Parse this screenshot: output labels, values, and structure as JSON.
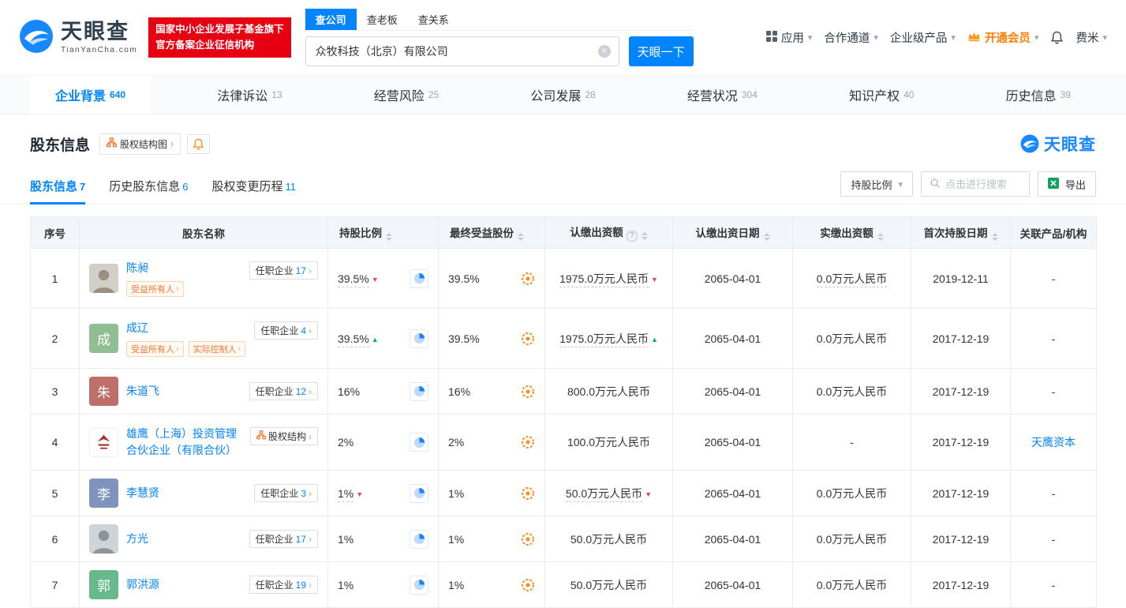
{
  "icons": {
    "caret_down": "▾",
    "arrow_right": "›",
    "close": "×",
    "question": "?",
    "up": "▲",
    "down": "▼"
  },
  "colors": {
    "accent_blue": "#0084ff",
    "badge_red": "#e60012",
    "vip_orange": "#ff8000",
    "trend_up_green": "#00b269",
    "trend_down_red": "#f3414d"
  },
  "brand": {
    "name": "天眼查",
    "domain": "TianYanCha.com",
    "badge_line1": "国家中小企业发展子基金旗下",
    "badge_line2": "官方备案企业征信机构"
  },
  "search": {
    "tabs": [
      {
        "label": "查公司"
      },
      {
        "label": "查老板"
      },
      {
        "label": "查关系"
      }
    ],
    "value": "众牧科技（北京）有限公司",
    "button": "天眼一下"
  },
  "topmenu": {
    "apps": "应用",
    "partner": "合作通道",
    "enterprise": "企业级产品",
    "vip": "开通会员",
    "user": "费米"
  },
  "nav_tabs": [
    {
      "label": "企业背景",
      "count": "640"
    },
    {
      "label": "法律诉讼",
      "count": "13"
    },
    {
      "label": "经营风险",
      "count": "25"
    },
    {
      "label": "公司发展",
      "count": "28"
    },
    {
      "label": "经营状况",
      "count": "304"
    },
    {
      "label": "知识产权",
      "count": "40"
    },
    {
      "label": "历史信息",
      "count": "39"
    }
  ],
  "section": {
    "title": "股东信息",
    "structure_chart": "股权结构图",
    "logo": "天眼查"
  },
  "sub_tabs": [
    {
      "label": "股东信息",
      "count": "7"
    },
    {
      "label": "历史股东信息",
      "count": "6"
    },
    {
      "label": "股权变更历程",
      "count": "11"
    }
  ],
  "controls": {
    "sort": "持股比例",
    "search_placeholder": "点击进行搜索",
    "export": "导出"
  },
  "table": {
    "headers": {
      "index": "序号",
      "name": "股东名称",
      "ratio": "持股比例",
      "final": "最终受益股份",
      "capital": "认缴出资额",
      "capital_date": "认缴出资日期",
      "paid": "实缴出资额",
      "first_date": "首次持股日期",
      "related": "关联产品/机构"
    },
    "rows": [
      {
        "index": "1",
        "name": "陈昶",
        "avatar_type": "photo",
        "badge_label": "任职企业",
        "badge_count": "17",
        "tags": [
          "受益所有人"
        ],
        "ratio": "39.5%",
        "ratio_trend": "down",
        "final": "39.5%",
        "capital": "1975.0万元人民币",
        "capital_trend": "down",
        "capital_date": "2065-04-01",
        "paid": "0.0万元人民币",
        "first_date": "2019-12-11",
        "related": "-"
      },
      {
        "index": "2",
        "name": "成辽",
        "avatar_type": "text",
        "avatar_text": "成",
        "avatar_color": "#8fbe93",
        "badge_label": "任职企业",
        "badge_count": "4",
        "tags": [
          "受益所有人",
          "实际控制人"
        ],
        "ratio": "39.5%",
        "ratio_trend": "up",
        "final": "39.5%",
        "capital": "1975.0万元人民币",
        "capital_trend": "up",
        "capital_date": "2065-04-01",
        "paid": "0.0万元人民币",
        "first_date": "2017-12-19",
        "related": "-"
      },
      {
        "index": "3",
        "name": "朱道飞",
        "avatar_type": "text",
        "avatar_text": "朱",
        "avatar_color": "#bd6f68",
        "badge_label": "任职企业",
        "badge_count": "12",
        "ratio": "16%",
        "final": "16%",
        "capital": "800.0万元人民币",
        "capital_date": "2065-04-01",
        "paid": "0.0万元人民币",
        "first_date": "2017-12-19",
        "related": "-"
      },
      {
        "index": "4",
        "name": "雄鹰（上海）投资管理合伙企业（有限合伙）",
        "avatar_type": "logo",
        "badge_label": "股权结构",
        "ratio": "2%",
        "final": "2%",
        "capital": "100.0万元人民币",
        "capital_date": "2065-04-01",
        "paid": "-",
        "first_date": "2017-12-19",
        "related": "天鹰资本"
      },
      {
        "index": "5",
        "name": "李慧贤",
        "avatar_type": "text",
        "avatar_text": "李",
        "avatar_color": "#8093bd",
        "badge_label": "任职企业",
        "badge_count": "3",
        "ratio": "1%",
        "ratio_trend": "down",
        "final": "1%",
        "capital": "50.0万元人民币",
        "capital_trend": "down",
        "capital_date": "2065-04-01",
        "paid": "0.0万元人民币",
        "first_date": "2017-12-19",
        "related": "-"
      },
      {
        "index": "6",
        "name": "方光",
        "avatar_type": "photo",
        "badge_label": "任职企业",
        "badge_count": "17",
        "ratio": "1%",
        "final": "1%",
        "capital": "50.0万元人民币",
        "capital_date": "2065-04-01",
        "paid": "0.0万元人民币",
        "first_date": "2017-12-19",
        "related": "-"
      },
      {
        "index": "7",
        "name": "郭洪源",
        "avatar_type": "text",
        "avatar_text": "郭",
        "avatar_color": "#67b98b",
        "badge_label": "任职企业",
        "badge_count": "19",
        "ratio": "1%",
        "final": "1%",
        "capital": "50.0万元人民币",
        "capital_date": "2065-04-01",
        "paid": "0.0万元人民币",
        "first_date": "2017-12-19",
        "related": "-"
      }
    ]
  }
}
